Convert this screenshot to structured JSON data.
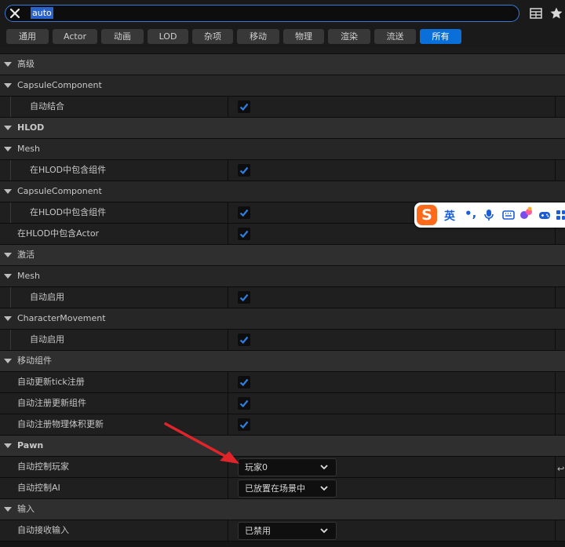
{
  "search": {
    "value": "auto"
  },
  "filters": [
    {
      "label": "通用",
      "active": false
    },
    {
      "label": "Actor",
      "active": false
    },
    {
      "label": "动画",
      "active": false
    },
    {
      "label": "LOD",
      "active": false
    },
    {
      "label": "杂项",
      "active": false
    },
    {
      "label": "移动",
      "active": false
    },
    {
      "label": "物理",
      "active": false
    },
    {
      "label": "渲染",
      "active": false
    },
    {
      "label": "流送",
      "active": false
    },
    {
      "label": "所有",
      "active": true
    }
  ],
  "sections": {
    "advanced": "高级",
    "capsule1": "CapsuleComponent",
    "auto_weld": "自动结合",
    "hlod": "HLOD",
    "mesh1": "Mesh",
    "include_hlod_1": "在HLOD中包含组件",
    "capsule2": "CapsuleComponent",
    "include_hlod_2": "在HLOD中包含组件",
    "include_actor_hlod": "在HLOD中包含Actor",
    "activation": "激活",
    "mesh2": "Mesh",
    "auto_activate_1": "自动启用",
    "char_movement": "CharacterMovement",
    "auto_activate_2": "自动启用",
    "movement_component": "移动组件",
    "auto_update_tick": "自动更新tick注册",
    "auto_register_update": "自动注册更新组件",
    "auto_register_physics": "自动注册物理体积更新",
    "pawn": "Pawn",
    "auto_possess_player": "自动控制玩家",
    "auto_possess_ai": "自动控制AI",
    "input": "输入",
    "auto_receive_input": "自动接收输入"
  },
  "values": {
    "auto_possess_player": "玩家0",
    "auto_possess_ai": "已放置在场景中",
    "auto_receive_input": "已禁用"
  },
  "ime": {
    "logo": "S",
    "lang": "英",
    "punct": "•,"
  },
  "colors": {
    "accent": "#0b6fd9",
    "check": "#2f7fe0",
    "annotation": "#e0252a"
  }
}
